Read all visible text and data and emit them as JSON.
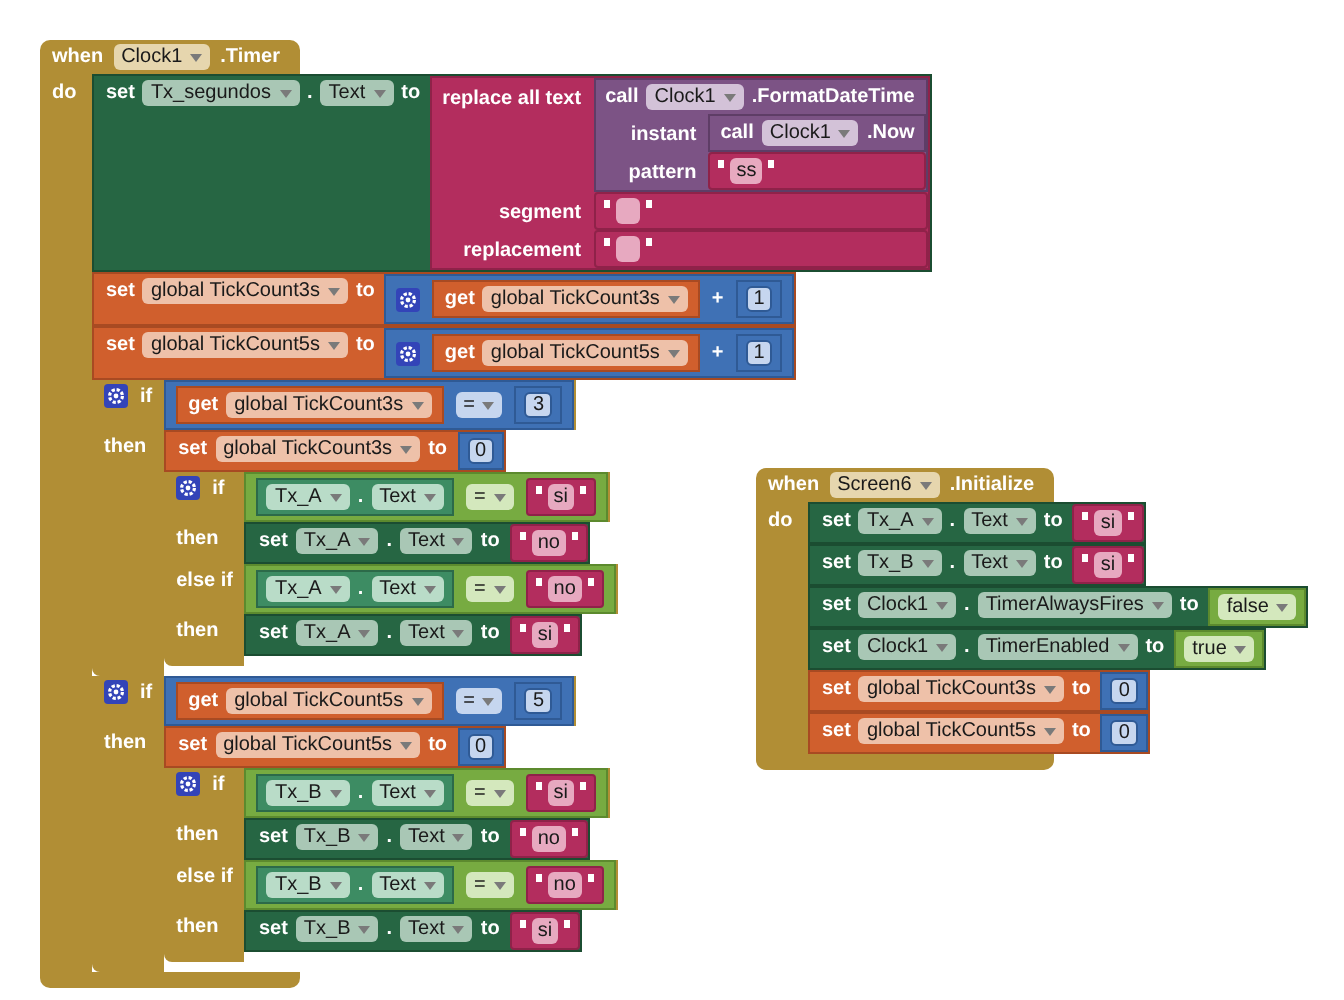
{
  "events": [
    {
      "keyword": "when",
      "component": "Clock1",
      "event": ".Timer",
      "do_label": "do",
      "body": [
        {
          "kind": "set_prop",
          "keyword": "set",
          "component": "Tx_segundos",
          "dot": ".",
          "property": "Text",
          "to": "to",
          "value": {
            "kind": "replace_all",
            "label": "replace all text",
            "text": {
              "kind": "call",
              "keyword": "call",
              "component": "Clock1",
              "method": ".FormatDateTime",
              "args": [
                {
                  "label": "instant",
                  "value": {
                    "kind": "call",
                    "keyword": "call",
                    "component": "Clock1",
                    "method": ".Now"
                  }
                },
                {
                  "label": "pattern",
                  "value": {
                    "kind": "text",
                    "value": "ss"
                  }
                }
              ]
            },
            "args": [
              {
                "label": "segment",
                "value": {
                  "kind": "text"
                }
              },
              {
                "label": "replacement",
                "value": {
                  "kind": "text"
                }
              }
            ]
          }
        },
        {
          "kind": "set_global",
          "keyword": "set",
          "variable": "global TickCount3s",
          "to": "to",
          "value": {
            "kind": "add",
            "left": {
              "kind": "get",
              "keyword": "get",
              "variable": "global TickCount3s"
            },
            "op": "+",
            "right": {
              "kind": "number",
              "value": "1"
            }
          }
        },
        {
          "kind": "set_global",
          "keyword": "set",
          "variable": "global TickCount5s",
          "to": "to",
          "value": {
            "kind": "add",
            "left": {
              "kind": "get",
              "keyword": "get",
              "variable": "global TickCount5s"
            },
            "op": "+",
            "right": {
              "kind": "number",
              "value": "1"
            }
          }
        },
        {
          "kind": "if",
          "branches": [
            {
              "label": "if",
              "cond": {
                "kind": "compare",
                "left": {
                  "kind": "get",
                  "keyword": "get",
                  "variable": "global TickCount3s"
                },
                "op": "=",
                "right": {
                  "kind": "number",
                  "value": "3"
                }
              },
              "then_label": "then",
              "body": [
                {
                  "kind": "set_global",
                  "keyword": "set",
                  "variable": "global TickCount3s",
                  "to": "to",
                  "value": {
                    "kind": "number",
                    "value": "0"
                  }
                },
                {
                  "kind": "if",
                  "branches": [
                    {
                      "label": "if",
                      "cond": {
                        "kind": "logic_compare",
                        "left": {
                          "kind": "get_prop",
                          "component": "Tx_A",
                          "dot": ".",
                          "property": "Text"
                        },
                        "op": "=",
                        "right": {
                          "kind": "text",
                          "value": "si"
                        }
                      },
                      "then_label": "then",
                      "body": [
                        {
                          "kind": "set_prop",
                          "keyword": "set",
                          "component": "Tx_A",
                          "dot": ".",
                          "property": "Text",
                          "to": "to",
                          "value": {
                            "kind": "text",
                            "value": "no"
                          }
                        }
                      ]
                    },
                    {
                      "label": "else if",
                      "cond": {
                        "kind": "logic_compare",
                        "left": {
                          "kind": "get_prop",
                          "component": "Tx_A",
                          "dot": ".",
                          "property": "Text"
                        },
                        "op": "=",
                        "right": {
                          "kind": "text",
                          "value": "no"
                        }
                      },
                      "then_label": "then",
                      "body": [
                        {
                          "kind": "set_prop",
                          "keyword": "set",
                          "component": "Tx_A",
                          "dot": ".",
                          "property": "Text",
                          "to": "to",
                          "value": {
                            "kind": "text",
                            "value": "si"
                          }
                        }
                      ]
                    }
                  ]
                }
              ]
            }
          ]
        },
        {
          "kind": "if",
          "branches": [
            {
              "label": "if",
              "cond": {
                "kind": "compare",
                "left": {
                  "kind": "get",
                  "keyword": "get",
                  "variable": "global TickCount5s"
                },
                "op": "=",
                "right": {
                  "kind": "number",
                  "value": "5"
                }
              },
              "then_label": "then",
              "body": [
                {
                  "kind": "set_global",
                  "keyword": "set",
                  "variable": "global TickCount5s",
                  "to": "to",
                  "value": {
                    "kind": "number",
                    "value": "0"
                  }
                },
                {
                  "kind": "if",
                  "branches": [
                    {
                      "label": "if",
                      "cond": {
                        "kind": "logic_compare",
                        "left": {
                          "kind": "get_prop",
                          "component": "Tx_B",
                          "dot": ".",
                          "property": "Text"
                        },
                        "op": "=",
                        "right": {
                          "kind": "text",
                          "value": "si"
                        }
                      },
                      "then_label": "then",
                      "body": [
                        {
                          "kind": "set_prop",
                          "keyword": "set",
                          "component": "Tx_B",
                          "dot": ".",
                          "property": "Text",
                          "to": "to",
                          "value": {
                            "kind": "text",
                            "value": "no"
                          }
                        }
                      ]
                    },
                    {
                      "label": "else if",
                      "cond": {
                        "kind": "logic_compare",
                        "left": {
                          "kind": "get_prop",
                          "component": "Tx_B",
                          "dot": ".",
                          "property": "Text"
                        },
                        "op": "=",
                        "right": {
                          "kind": "text",
                          "value": "no"
                        }
                      },
                      "then_label": "then",
                      "body": [
                        {
                          "kind": "set_prop",
                          "keyword": "set",
                          "component": "Tx_B",
                          "dot": ".",
                          "property": "Text",
                          "to": "to",
                          "value": {
                            "kind": "text",
                            "value": "si"
                          }
                        }
                      ]
                    }
                  ]
                }
              ]
            }
          ]
        }
      ]
    },
    {
      "keyword": "when",
      "component": "Screen6",
      "event": ".Initialize",
      "do_label": "do",
      "body": [
        {
          "kind": "set_prop",
          "keyword": "set",
          "component": "Tx_A",
          "dot": ".",
          "property": "Text",
          "to": "to",
          "value": {
            "kind": "text",
            "value": "si"
          }
        },
        {
          "kind": "set_prop",
          "keyword": "set",
          "component": "Tx_B",
          "dot": ".",
          "property": "Text",
          "to": "to",
          "value": {
            "kind": "text",
            "value": "si"
          }
        },
        {
          "kind": "set_prop",
          "keyword": "set",
          "component": "Clock1",
          "dot": ".",
          "property": "TimerAlwaysFires",
          "to": "to",
          "value": {
            "kind": "bool",
            "value": "false"
          }
        },
        {
          "kind": "set_prop",
          "keyword": "set",
          "component": "Clock1",
          "dot": ".",
          "property": "TimerEnabled",
          "to": "to",
          "value": {
            "kind": "bool",
            "value": "true"
          }
        },
        {
          "kind": "set_global",
          "keyword": "set",
          "variable": "global TickCount3s",
          "to": "to",
          "value": {
            "kind": "number",
            "value": "0"
          }
        },
        {
          "kind": "set_global",
          "keyword": "set",
          "variable": "global TickCount5s",
          "to": "to",
          "value": {
            "kind": "number",
            "value": "0"
          }
        }
      ]
    }
  ]
}
